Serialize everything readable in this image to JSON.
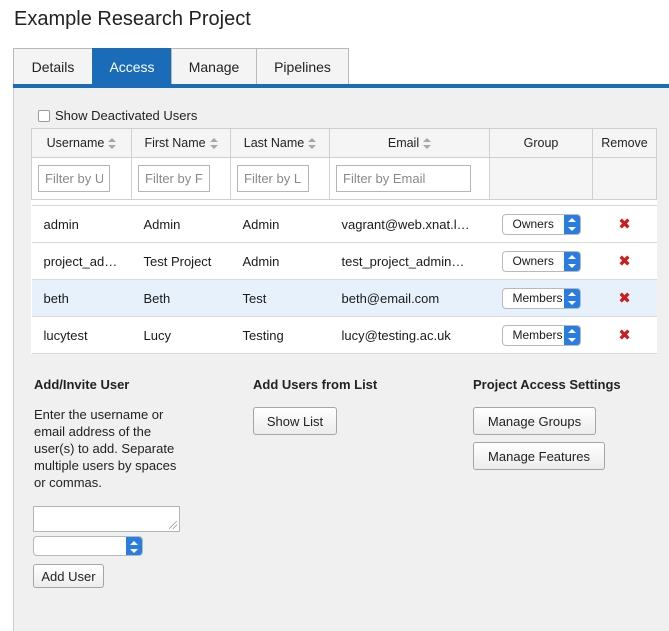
{
  "page_title": "Example Research Project",
  "tabs": [
    {
      "label": "Details"
    },
    {
      "label": "Access"
    },
    {
      "label": "Manage"
    },
    {
      "label": "Pipelines"
    }
  ],
  "show_deactivated_label": "Show Deactivated Users",
  "table": {
    "headers": {
      "username": "Username",
      "first_name": "First Name",
      "last_name": "Last Name",
      "email": "Email",
      "group": "Group",
      "remove": "Remove"
    },
    "filters": {
      "username": "Filter by U",
      "first_name": "Filter by F",
      "last_name": "Filter by L",
      "email": "Filter by Email"
    },
    "rows": [
      {
        "username": "admin",
        "first_name": "Admin",
        "last_name": "Admin",
        "email": "vagrant@web.xnat.l…",
        "group": "Owners"
      },
      {
        "username": "project_ad…",
        "first_name": "Test Project",
        "last_name": "Admin",
        "email": "test_project_admin…",
        "group": "Owners"
      },
      {
        "username": "beth",
        "first_name": "Beth",
        "last_name": "Test",
        "email": "beth@email.com",
        "group": "Members"
      },
      {
        "username": "lucytest",
        "first_name": "Lucy",
        "last_name": "Testing",
        "email": "lucy@testing.ac.uk",
        "group": "Members"
      }
    ],
    "remove_glyph": "✖",
    "highlight_color": "#e6f1fb"
  },
  "add_invite": {
    "heading": "Add/Invite User",
    "instructions": "Enter the username or email address of the user(s) to add. Separate multiple users by spaces or commas.",
    "add_button": "Add User"
  },
  "add_from_list": {
    "heading": "Add Users from List",
    "button": "Show List"
  },
  "access_settings": {
    "heading": "Project Access Settings",
    "manage_groups": "Manage Groups",
    "manage_features": "Manage Features"
  },
  "colors": {
    "accent": "#1a6cb8",
    "select_button": "#2a7de0",
    "remove": "#d11a1a"
  }
}
